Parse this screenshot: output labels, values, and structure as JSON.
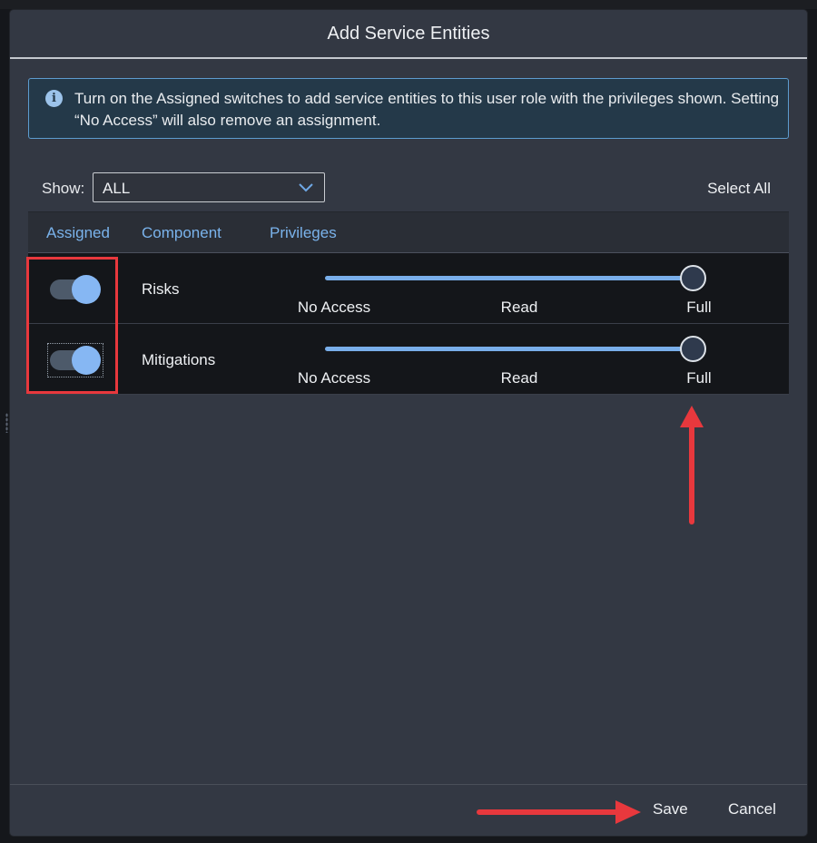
{
  "dialog": {
    "title": "Add Service Entities",
    "info_icon": "info-icon",
    "info_text": "Turn on the Assigned switches to add service entities to this user role with the privileges shown. Setting “No Access” will also remove an assignment."
  },
  "filter": {
    "show_label": "Show:",
    "show_value": "ALL",
    "select_all_label": "Select All"
  },
  "table": {
    "headers": [
      "Assigned",
      "Component",
      "Privileges"
    ],
    "privilege_levels": [
      "No Access",
      "Read",
      "Full"
    ],
    "rows": [
      {
        "component": "Risks",
        "assigned": true,
        "privilege": "Full"
      },
      {
        "component": "Mitigations",
        "assigned": true,
        "privilege": "Full"
      }
    ]
  },
  "footer": {
    "save_label": "Save",
    "cancel_label": "Cancel"
  },
  "colors": {
    "accent": "#7ab3ec",
    "annotation": "#e8383d",
    "dialog_bg": "#333843",
    "row_bg": "#14161a"
  }
}
